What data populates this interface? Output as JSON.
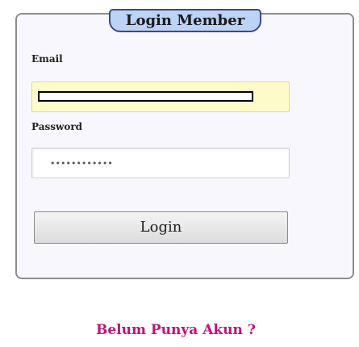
{
  "form": {
    "legend": "Login Member",
    "email_label": "Email",
    "email_value": "",
    "password_label": "Password",
    "password_value_masked": "••••••••••••",
    "login_button_label": "Login"
  },
  "register": {
    "link_text": "Belum Punya Akun ?"
  },
  "colors": {
    "legend_bg": "#bcd2f7",
    "email_field_bg": "#fdfcc9",
    "link_color": "#c0127a",
    "panel_bg": "#f7f7fd"
  }
}
